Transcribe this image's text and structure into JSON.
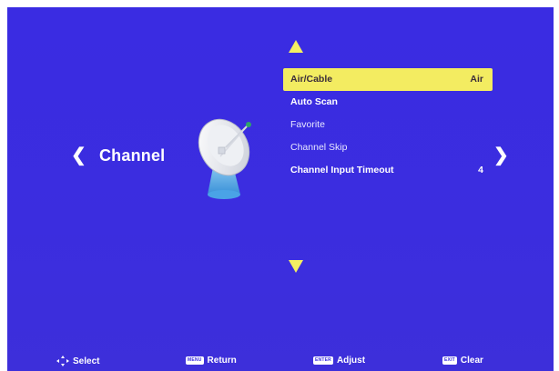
{
  "section": {
    "title": "Channel"
  },
  "menu": {
    "items": [
      {
        "label": "Air/Cable",
        "value": "Air",
        "selected": true
      },
      {
        "label": "Auto Scan",
        "value": ""
      },
      {
        "label": "Favorite",
        "value": ""
      },
      {
        "label": "Channel Skip",
        "value": ""
      },
      {
        "label": "Channel Input Timeout",
        "value": "4"
      }
    ]
  },
  "footer": {
    "select_label": "Select",
    "return_key": "MENU",
    "return_label": "Return",
    "adjust_key": "ENTER",
    "adjust_label": "Adjust",
    "clear_key": "EXIT",
    "clear_label": "Clear"
  },
  "colors": {
    "background": "#3b2ddf",
    "highlight": "#f3ec61",
    "text": "#ffffff"
  },
  "icons": [
    "chevron-left-icon",
    "chevron-right-icon",
    "arrow-up-icon",
    "arrow-down-icon",
    "satellite-dish-icon",
    "dpad-icon"
  ]
}
